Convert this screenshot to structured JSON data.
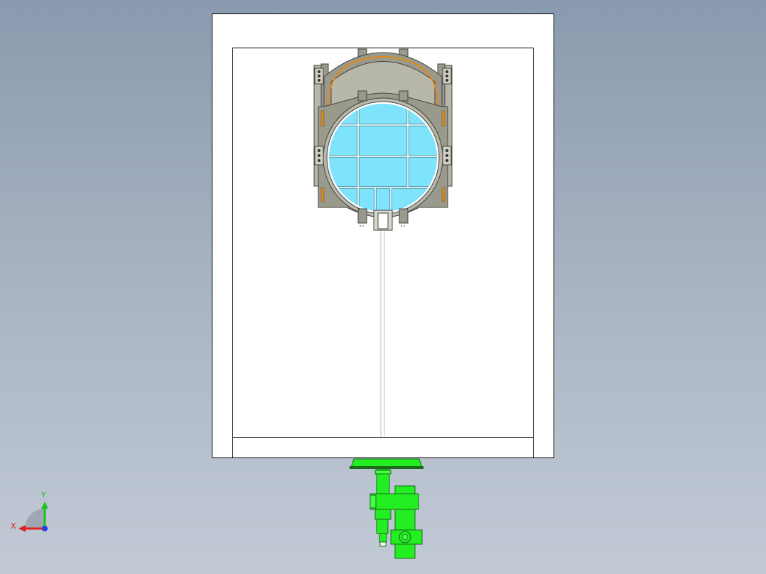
{
  "scene": {
    "description_colors": {
      "background_top": "#8a9aae",
      "background_bottom": "#c2cad6",
      "frame": "#ffffff",
      "steel": "#9a9a8c",
      "steel_dark": "#6e6e62",
      "glass": "#7fe3fb",
      "gasket": "#e08a18",
      "actuator": "#22ee22"
    }
  },
  "triad": {
    "x_label": "X",
    "y_label": "Y",
    "x_color": "#e02020",
    "y_color": "#20c020",
    "z_color": "#2040e0"
  }
}
